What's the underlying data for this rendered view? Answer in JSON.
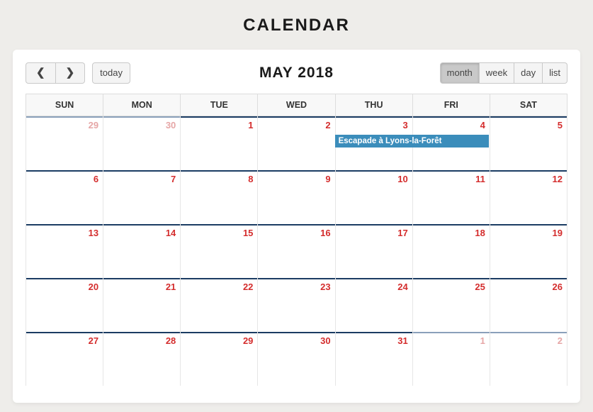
{
  "page_title": "CALENDAR",
  "month_title": "MAY 2018",
  "toolbar": {
    "today_label": "today",
    "views": {
      "month": "month",
      "week": "week",
      "day": "day",
      "list": "list"
    },
    "active_view": "month"
  },
  "day_headers": [
    "SUN",
    "MON",
    "TUE",
    "WED",
    "THU",
    "FRI",
    "SAT"
  ],
  "weeks": [
    {
      "days": [
        {
          "n": "29",
          "muted": true
        },
        {
          "n": "30",
          "muted": true
        },
        {
          "n": "1"
        },
        {
          "n": "2"
        },
        {
          "n": "3",
          "event": {
            "title": "Escapade à Lyons-la-Forêt",
            "span": 2
          }
        },
        {
          "n": "4"
        },
        {
          "n": "5"
        }
      ]
    },
    {
      "days": [
        {
          "n": "6"
        },
        {
          "n": "7"
        },
        {
          "n": "8"
        },
        {
          "n": "9"
        },
        {
          "n": "10"
        },
        {
          "n": "11"
        },
        {
          "n": "12"
        }
      ]
    },
    {
      "days": [
        {
          "n": "13"
        },
        {
          "n": "14"
        },
        {
          "n": "15"
        },
        {
          "n": "16"
        },
        {
          "n": "17"
        },
        {
          "n": "18"
        },
        {
          "n": "19"
        }
      ]
    },
    {
      "days": [
        {
          "n": "20"
        },
        {
          "n": "21"
        },
        {
          "n": "22"
        },
        {
          "n": "23"
        },
        {
          "n": "24"
        },
        {
          "n": "25"
        },
        {
          "n": "26"
        }
      ]
    },
    {
      "days": [
        {
          "n": "27"
        },
        {
          "n": "28"
        },
        {
          "n": "29"
        },
        {
          "n": "30"
        },
        {
          "n": "31"
        },
        {
          "n": "1",
          "muted": true
        },
        {
          "n": "2",
          "muted": true
        }
      ]
    }
  ],
  "colors": {
    "accent": "#3b8dbb",
    "date": "#d42d2d"
  }
}
